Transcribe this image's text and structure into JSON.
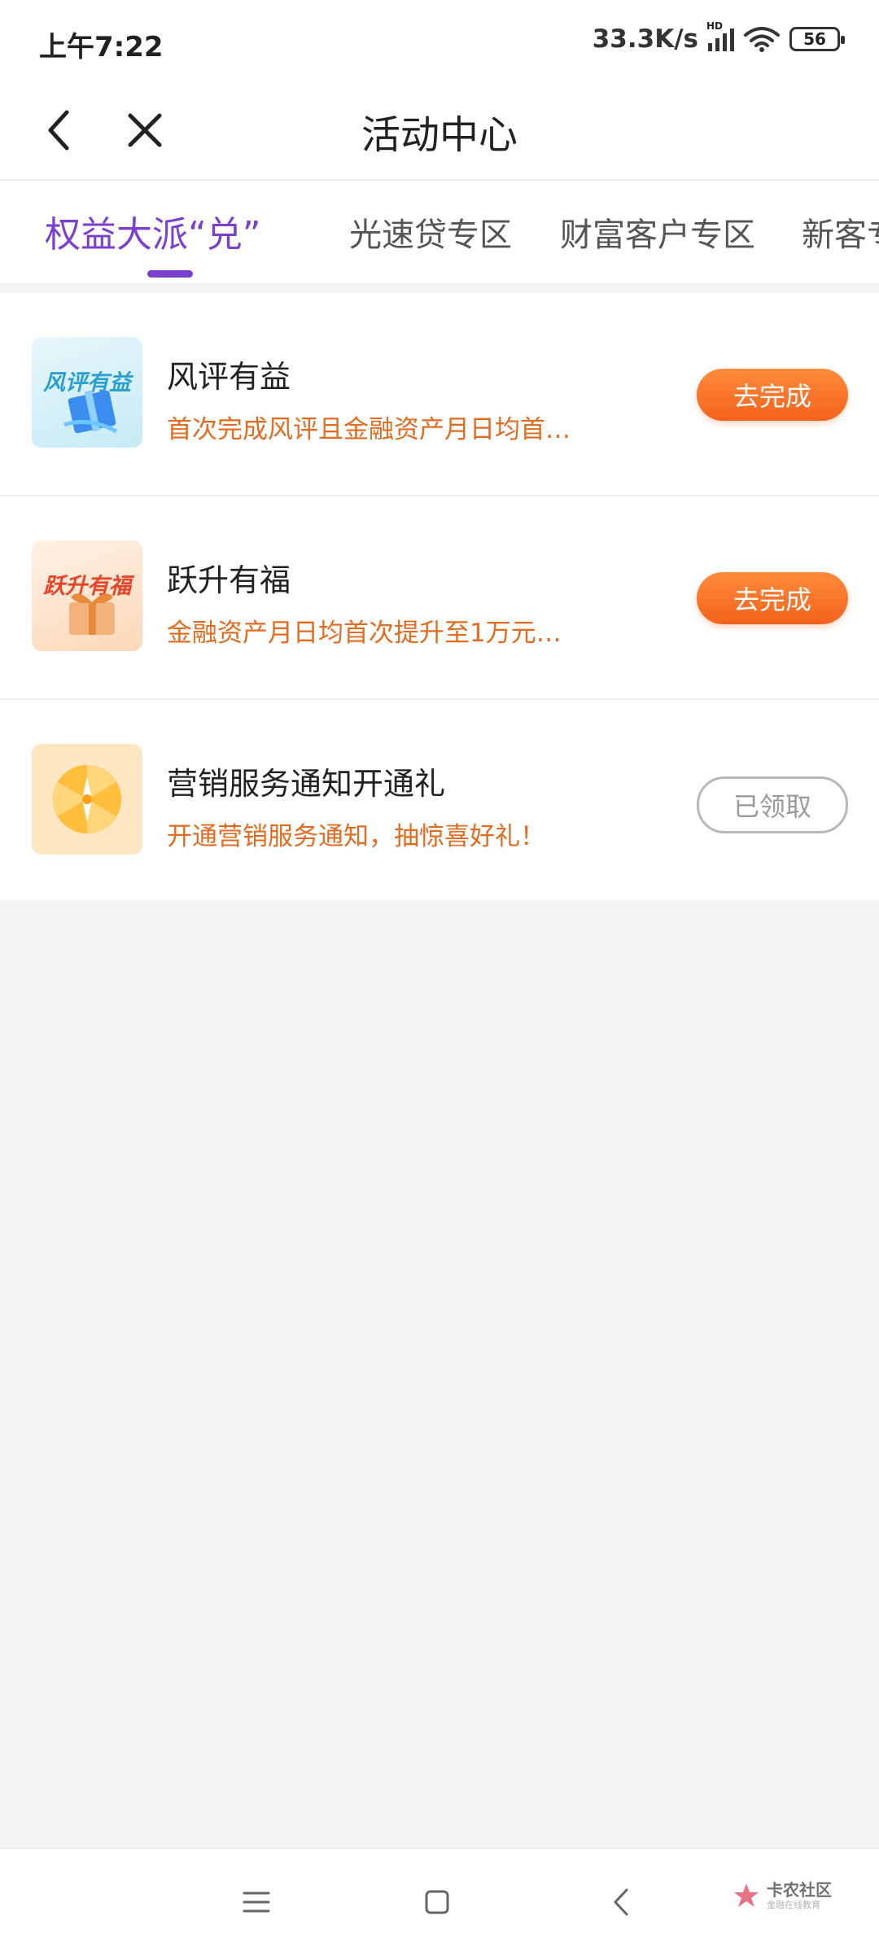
{
  "status_bar": {
    "time": "上午7:22",
    "net_speed": "33.3K/s",
    "signal_label": "HD",
    "battery": "56"
  },
  "header": {
    "title": "活动中心",
    "back_icon": "chevron-left-icon",
    "close_icon": "close-icon"
  },
  "tabs": [
    {
      "label": "权益大派“兑”",
      "active": true
    },
    {
      "label": "光速贷专区",
      "active": false
    },
    {
      "label": "财富客户专区",
      "active": false
    },
    {
      "label": "新客专区",
      "active": false
    }
  ],
  "activities": [
    {
      "title": "风评有益",
      "description": "首次完成风评且金融资产月日均首…",
      "thumb_text": "风评有益",
      "button": "去完成",
      "status": "pending"
    },
    {
      "title": "跃升有福",
      "description": "金融资产月日均首次提升至1万元…",
      "thumb_text": "跃升有福",
      "button": "去完成",
      "status": "pending"
    },
    {
      "title": "营销服务通知开通礼",
      "description": "开通营销服务通知，抽惊喜好礼！",
      "button": "已领取",
      "status": "claimed"
    }
  ],
  "nav_bar": {
    "menu_icon": "menu-icon",
    "home_icon": "home-square-icon",
    "back_icon": "back-triangle-icon"
  },
  "watermark": {
    "main": "卡农社区",
    "sub": "金融在线教育"
  },
  "colors": {
    "accent": "#7a3fce",
    "action": "#f4621c",
    "desc": "#e36b1f",
    "claimed": "#9a9a9a"
  }
}
